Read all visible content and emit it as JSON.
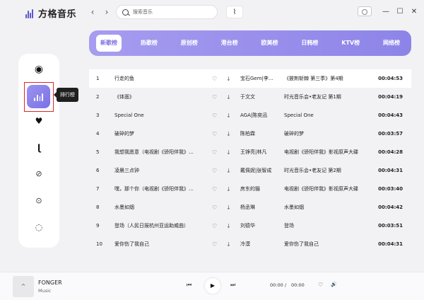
{
  "app": {
    "name": "方格音乐"
  },
  "header": {
    "back_icon": "chevron-left-icon",
    "forward_icon": "chevron-right-icon",
    "search_placeholder": "搜索音乐",
    "wave_icon": "waveform-icon",
    "win_minimize": "—",
    "win_maximize": "☐",
    "win_close": "✕"
  },
  "sidebar": {
    "items": [
      {
        "icon": "disc-icon",
        "glyph": "◉"
      },
      {
        "icon": "chart-bars-icon",
        "glyph": ""
      },
      {
        "icon": "heart-icon",
        "glyph": "♥"
      },
      {
        "icon": "music-note-icon",
        "glyph": "ɭ"
      },
      {
        "icon": "ban-icon",
        "glyph": "⊘"
      },
      {
        "icon": "toggle-icon",
        "glyph": "⊙"
      },
      {
        "icon": "leaf-icon",
        "glyph": "◌"
      }
    ],
    "tooltip": "排行榜"
  },
  "tabs": [
    {
      "label": "新歌榜",
      "active": true
    },
    {
      "label": "热歌榜",
      "active": false
    },
    {
      "label": "原创榜",
      "active": false
    },
    {
      "label": "港台榜",
      "active": false
    },
    {
      "label": "欧美榜",
      "active": false
    },
    {
      "label": "日韩榜",
      "active": false
    },
    {
      "label": "KTV榜",
      "active": false
    },
    {
      "label": "网络榜",
      "active": false
    }
  ],
  "songs": [
    {
      "num": "1",
      "title": "行走的鱼",
      "artist": "宝石Gem|李...",
      "album": "《披荆斩棘 第三季》第4期",
      "duration": "00:04:53"
    },
    {
      "num": "2",
      "title": "《体面》",
      "artist": "于文文",
      "album": "时光音乐会•老友记 第1期",
      "duration": "00:04:19"
    },
    {
      "num": "3",
      "title": "Special One",
      "artist": "AGA|陈奕迅",
      "album": "Special One",
      "duration": "00:04:43"
    },
    {
      "num": "4",
      "title": "破碎的梦",
      "artist": "陈柏霖",
      "album": "破碎的梦",
      "duration": "00:03:57"
    },
    {
      "num": "5",
      "title": "我想我愿意（电视剧《骄阳伴我》...",
      "artist": "王铮亮|林凡",
      "album": "电视剧《骄阳伴我》影视原声大碟",
      "duration": "00:04:28"
    },
    {
      "num": "6",
      "title": "凌晨三点钟",
      "artist": "戴佩妮|张智成",
      "album": "时光音乐会•老友记 第2期",
      "duration": "00:04:31"
    },
    {
      "num": "7",
      "title": "嘿，那个你（电视剧《骄阳伴我》...",
      "artist": "房东的猫",
      "album": "电视剧《骄阳伴我》影视原声大碟",
      "duration": "00:03:40"
    },
    {
      "num": "8",
      "title": "水墨如烟",
      "artist": "杨丞琳",
      "album": "水墨如烟",
      "duration": "00:04:42"
    },
    {
      "num": "9",
      "title": "登场（人民日报杭州亚运助威曲）",
      "artist": "刘德华",
      "album": "登场",
      "duration": "00:03:51"
    },
    {
      "num": "10",
      "title": "爱你伤了我自己",
      "artist": "冷漠",
      "album": "爱你伤了我自己",
      "duration": "00:04:31"
    }
  ],
  "player": {
    "cover_glyph": "^",
    "title": "FONGER",
    "subtitle": "Music",
    "prev_glyph": "⏮",
    "play_glyph": "▶",
    "next_glyph": "⏭",
    "time_current": "00:00",
    "time_sep": "/",
    "time_total": "00:00",
    "like_glyph": "♡",
    "volume_glyph": "🔊"
  },
  "colors": {
    "accent": "#8d84e8",
    "active_tab_text": "#7c73e4",
    "highlight_border": "#e0262b"
  }
}
